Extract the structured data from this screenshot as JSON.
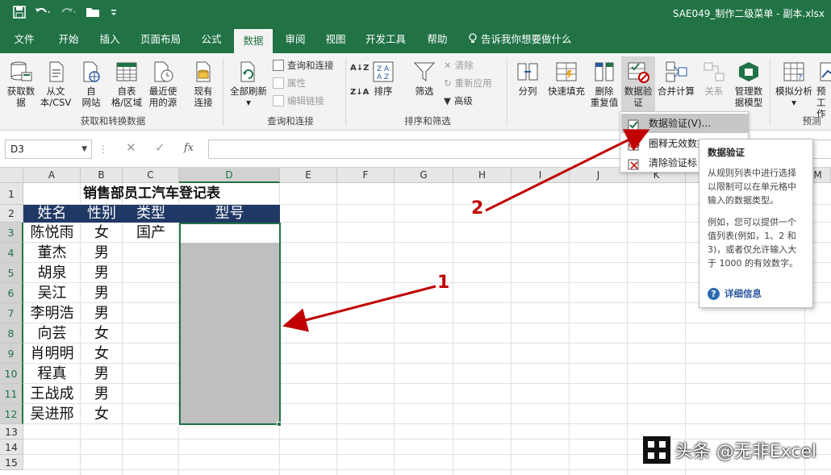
{
  "window": {
    "title": "SAE049_制作二级菜单 - 副本.xlsx"
  },
  "tabs": [
    {
      "label": "文件"
    },
    {
      "label": "开始"
    },
    {
      "label": "插入"
    },
    {
      "label": "页面布局"
    },
    {
      "label": "公式"
    },
    {
      "label": "数据"
    },
    {
      "label": "审阅"
    },
    {
      "label": "视图"
    },
    {
      "label": "开发工具"
    },
    {
      "label": "帮助"
    }
  ],
  "tell_me": "告诉我你想要做什么",
  "ribbon": {
    "get_data": "获取数",
    "get_data2": "据",
    "from_csv": "从文",
    "from_csv2": "本/CSV",
    "from_web": "自",
    "from_web2": "网站",
    "from_table": "自表",
    "from_table2": "格/区域",
    "recent": "最近使",
    "recent2": "用的源",
    "existing": "现有",
    "existing2": "连接",
    "group_get": "获取和转换数据",
    "refresh_all": "全部刷新",
    "queries": "查询和连接",
    "properties": "属性",
    "edit_links": "编辑链接",
    "group_queries": "查询和连接",
    "sort": "排序",
    "filter": "筛选",
    "clear": "清除",
    "reapply": "重新应用",
    "advanced": "高级",
    "group_sort": "排序和筛选",
    "split": "分列",
    "flash_fill": "快速填充",
    "remove_dup": "删除",
    "remove_dup2": "重复值",
    "validation": "数据验",
    "validation2": "证",
    "consolidate": "合并计算",
    "relations": "关系",
    "manage_model": "管理数",
    "manage_model2": "据模型",
    "whatif": "模拟分析",
    "forecast": "预",
    "forecast2": "工作",
    "group_forecast": "预测",
    "az": "A↓Z",
    "za": "Z↓A"
  },
  "formula_bar": {
    "name_box": "D3",
    "fx": "fx"
  },
  "columns": [
    "A",
    "B",
    "C",
    "D",
    "E",
    "F",
    "G",
    "H",
    "I",
    "J",
    "K",
    "L",
    "M"
  ],
  "rows": [
    "1",
    "2",
    "3",
    "4",
    "5",
    "6",
    "7",
    "8",
    "9",
    "10",
    "11",
    "12",
    "13",
    "14",
    "15"
  ],
  "sheet": {
    "title": "销售部员工汽车登记表",
    "headers": [
      "姓名",
      "性别",
      "类型",
      "型号"
    ],
    "data": [
      [
        "陈悦雨",
        "女",
        "国产"
      ],
      [
        "董杰",
        "男",
        ""
      ],
      [
        "胡泉",
        "男",
        ""
      ],
      [
        "吴江",
        "男",
        ""
      ],
      [
        "李明浩",
        "男",
        ""
      ],
      [
        "向芸",
        "女",
        ""
      ],
      [
        "肖明明",
        "女",
        ""
      ],
      [
        "程真",
        "男",
        ""
      ],
      [
        "王战成",
        "男",
        ""
      ],
      [
        "吴进邢",
        "女",
        ""
      ]
    ]
  },
  "menu": {
    "items": [
      "数据验证(V)...",
      "圈释无效数据",
      "清除验证标"
    ]
  },
  "tooltip": {
    "title": "数据验证",
    "para1": "从规则列表中进行选择以限制可以在单元格中输入的数据类型。",
    "para2": "例如，您可以提供一个值列表(例如，1、2 和 3)，或者仅允许输入大于 1000 的有效数字。",
    "more": "详细信息"
  },
  "annotations": {
    "one": "1",
    "two": "2"
  },
  "watermark": "头条 @无非Excel",
  "colors": {
    "accent": "#217346",
    "header_fill": "#203864",
    "arrow": "#c00000",
    "selection": "#bfbfbf"
  }
}
